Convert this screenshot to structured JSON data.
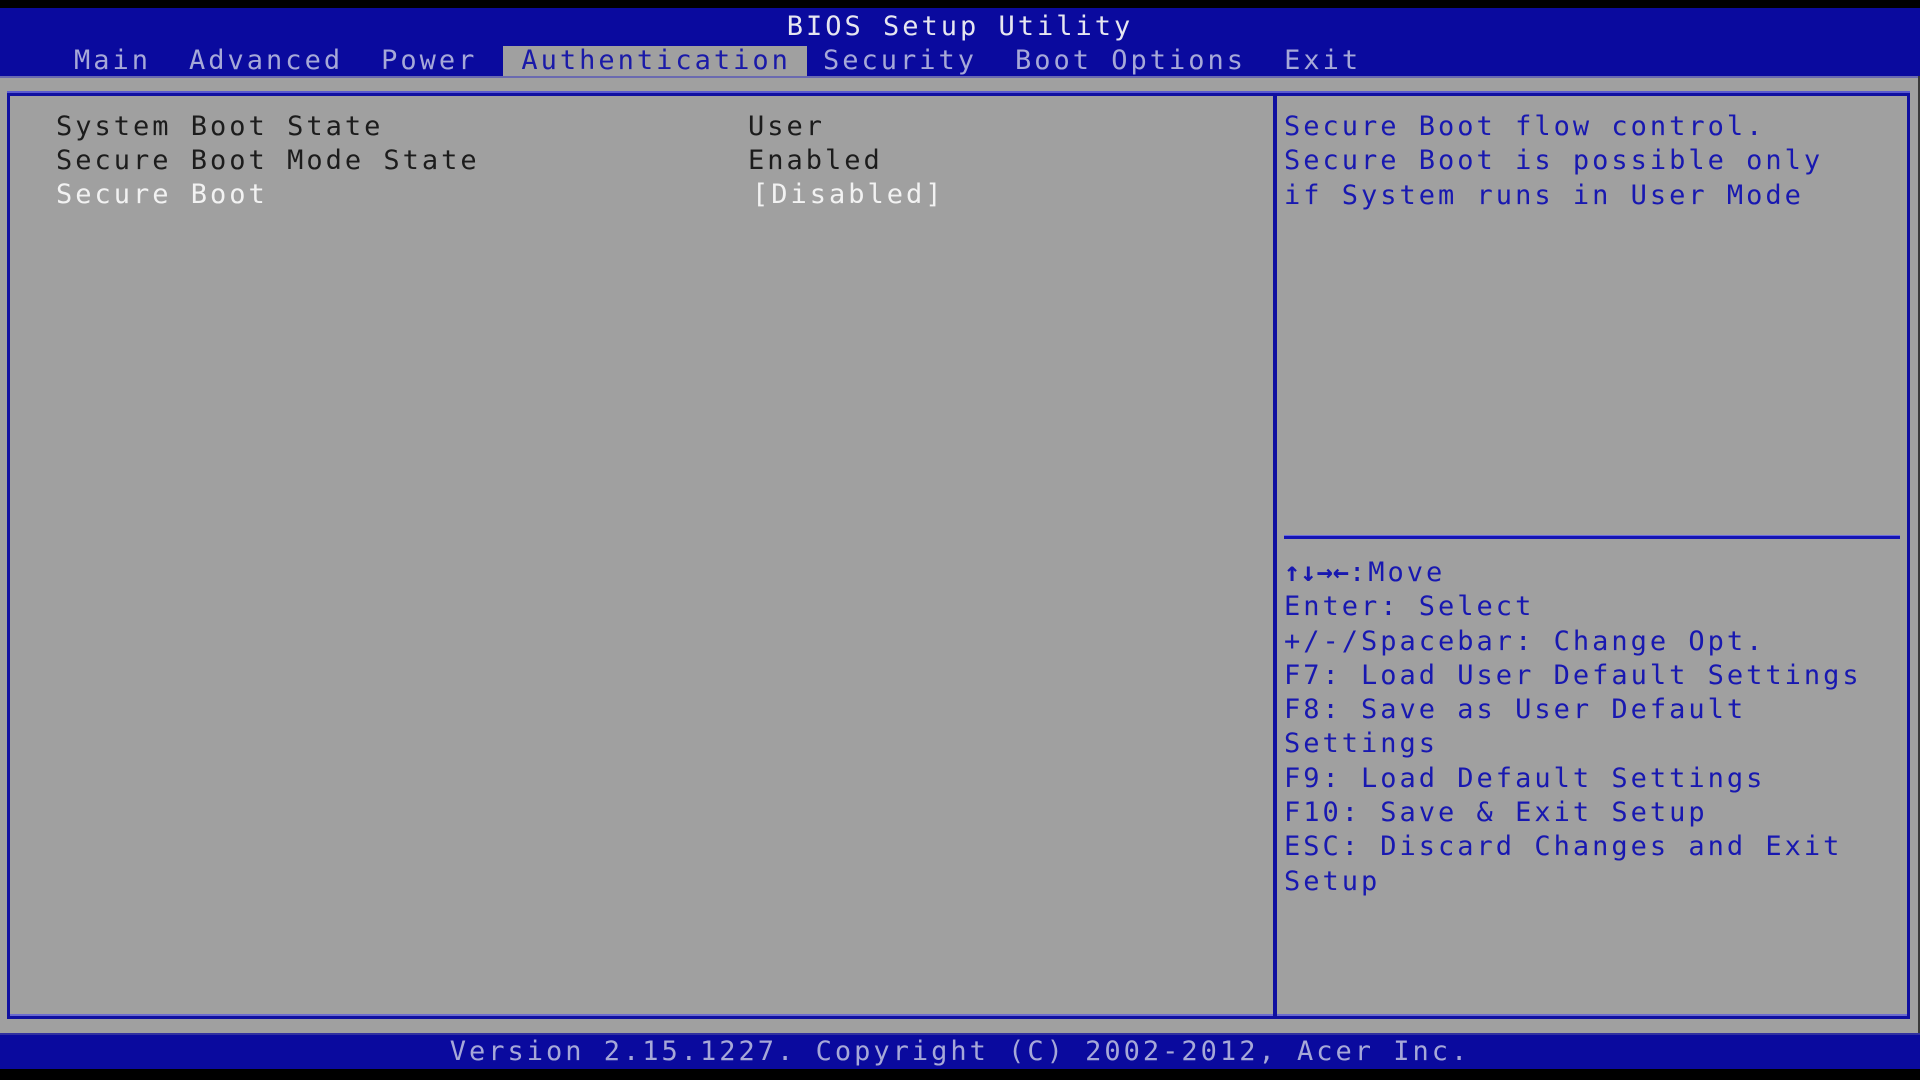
{
  "header": {
    "title": "BIOS Setup Utility",
    "tabs": [
      {
        "label": "Main",
        "active": false
      },
      {
        "label": "Advanced",
        "active": false
      },
      {
        "label": "Power",
        "active": false
      },
      {
        "label": "Authentication",
        "active": true
      },
      {
        "label": "Security",
        "active": false
      },
      {
        "label": "Boot Options",
        "active": false
      },
      {
        "label": "Exit",
        "active": false
      }
    ]
  },
  "settings": [
    {
      "label": "System Boot State",
      "value": "User",
      "selected": false
    },
    {
      "label": "Secure Boot Mode State",
      "value": "Enabled",
      "selected": false
    },
    {
      "label": "Secure Boot",
      "value": "[Disabled]",
      "selected": true
    }
  ],
  "help": {
    "lines": [
      "Secure Boot flow control.",
      "Secure Boot is possible only",
      "if System runs in User Mode"
    ]
  },
  "keys": {
    "move_arrows": "↑↓→←",
    "move_label": ":Move",
    "lines": [
      "Enter: Select",
      "+/-/Spacebar: Change Opt.",
      "F7: Load User Default Settings",
      "F8: Save as User Default",
      "Settings",
      "F9: Load Default Settings",
      "F10: Save & Exit Setup",
      "ESC: Discard Changes and Exit",
      "Setup"
    ]
  },
  "footer": {
    "text": "Version 2.15.1227. Copyright (C) 2002-2012, Acer Inc."
  },
  "colors": {
    "header_blue": "#0a0a9e",
    "panel_gray": "#a0a0a0",
    "help_text": "#1818b0",
    "selected_text": "#f2f2f2"
  }
}
